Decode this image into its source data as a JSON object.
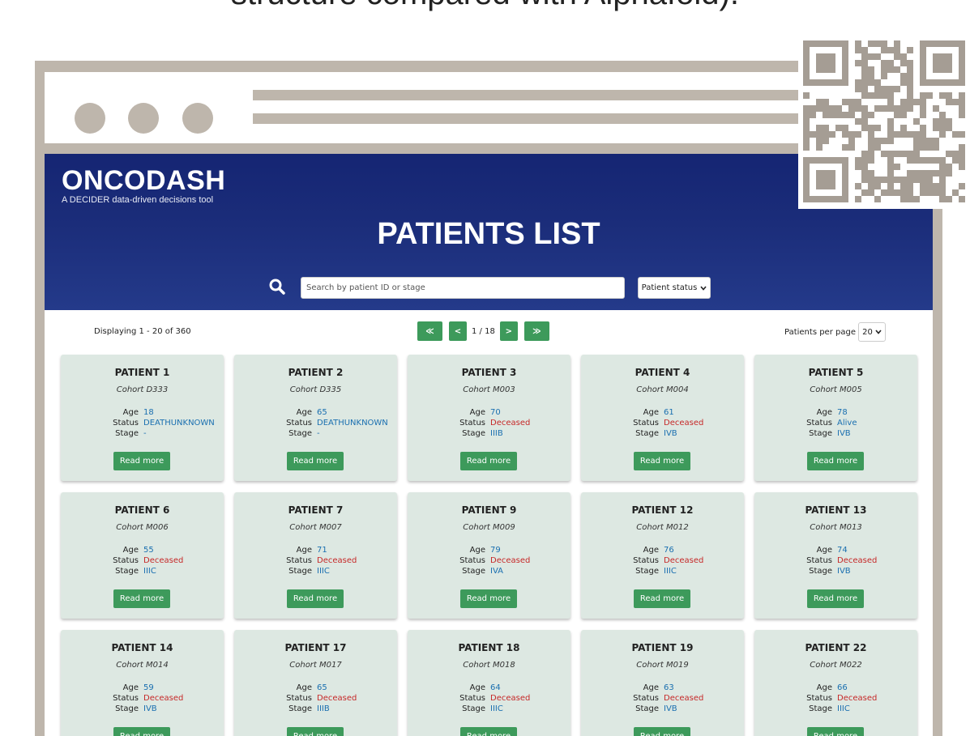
{
  "caption": "structure compared with Alphafold).",
  "app": {
    "logo_main": "ONCODASH",
    "logo_sub": "A DECIDER data-driven decisions tool",
    "page_title": "PATIENTS LIST",
    "search": {
      "placeholder": "Search by patient ID or stage",
      "value": ""
    },
    "status_filter": {
      "selected": "Patient status"
    },
    "displaying": "Displaying 1 - 20 of 360",
    "pager": {
      "first": "≪",
      "prev": "<",
      "page": "1 / 18",
      "next": ">",
      "last": "≫"
    },
    "per_page": {
      "label": "Patients per page",
      "selected": "20"
    },
    "labels": {
      "age": "Age",
      "status": "Status",
      "stage": "Stage",
      "read_more": "Read more"
    },
    "colors": {
      "header": "#1b2d7a",
      "accent_green": "#3d9a5b",
      "value_blue": "#1a6fb0",
      "value_red": "#c62828",
      "card_bg": "#dde8e2"
    },
    "patients": [
      {
        "name": "PATIENT 1",
        "cohort": "Cohort D333",
        "age": "18",
        "status": "DEATHUNKNOWN",
        "stage": "-"
      },
      {
        "name": "PATIENT 2",
        "cohort": "Cohort D335",
        "age": "65",
        "status": "DEATHUNKNOWN",
        "stage": "-"
      },
      {
        "name": "PATIENT 3",
        "cohort": "Cohort M003",
        "age": "70",
        "status": "Deceased",
        "stage": "IIIB"
      },
      {
        "name": "PATIENT 4",
        "cohort": "Cohort M004",
        "age": "61",
        "status": "Deceased",
        "stage": "IVB"
      },
      {
        "name": "PATIENT 5",
        "cohort": "Cohort M005",
        "age": "78",
        "status": "Alive",
        "stage": "IVB"
      },
      {
        "name": "PATIENT 6",
        "cohort": "Cohort M006",
        "age": "55",
        "status": "Deceased",
        "stage": "IIIC"
      },
      {
        "name": "PATIENT 7",
        "cohort": "Cohort M007",
        "age": "71",
        "status": "Deceased",
        "stage": "IIIC"
      },
      {
        "name": "PATIENT 9",
        "cohort": "Cohort M009",
        "age": "79",
        "status": "Deceased",
        "stage": "IVA"
      },
      {
        "name": "PATIENT 12",
        "cohort": "Cohort M012",
        "age": "76",
        "status": "Deceased",
        "stage": "IIIC"
      },
      {
        "name": "PATIENT 13",
        "cohort": "Cohort M013",
        "age": "74",
        "status": "Deceased",
        "stage": "IVB"
      },
      {
        "name": "PATIENT 14",
        "cohort": "Cohort M014",
        "age": "59",
        "status": "Deceased",
        "stage": "IVB"
      },
      {
        "name": "PATIENT 17",
        "cohort": "Cohort M017",
        "age": "65",
        "status": "Deceased",
        "stage": "IIIB"
      },
      {
        "name": "PATIENT 18",
        "cohort": "Cohort M018",
        "age": "64",
        "status": "Deceased",
        "stage": "IIIC"
      },
      {
        "name": "PATIENT 19",
        "cohort": "Cohort M019",
        "age": "63",
        "status": "Deceased",
        "stage": "IVB"
      },
      {
        "name": "PATIENT 22",
        "cohort": "Cohort M022",
        "age": "66",
        "status": "Deceased",
        "stage": "IIIC"
      }
    ]
  }
}
